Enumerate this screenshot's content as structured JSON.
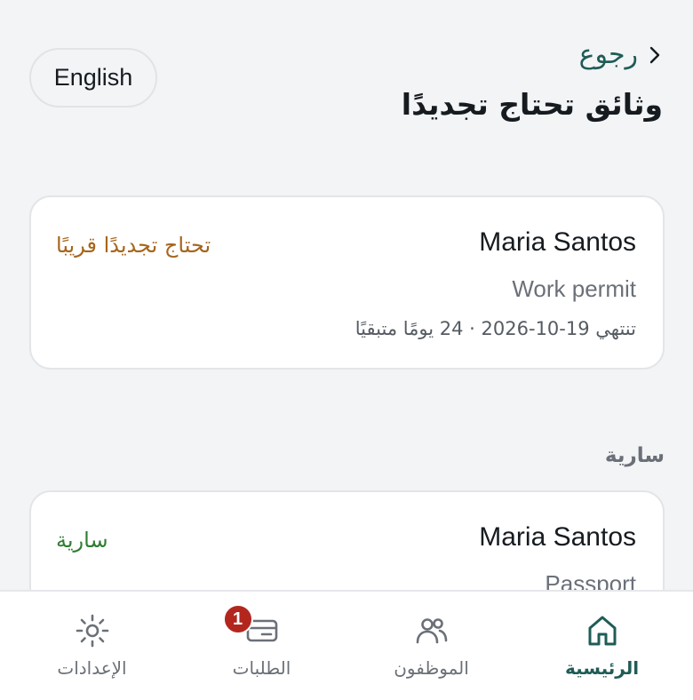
{
  "header": {
    "back_label": "رجوع",
    "title": "وثائق تحتاج تجديدًا",
    "language_toggle": "English"
  },
  "documents": [
    {
      "name": "Maria Santos",
      "document": "Work permit",
      "status": "تحتاج تجديدًا قريبًا",
      "expiry": "تنتهي 19-10-2026 · 24 يومًا متبقيًا",
      "status_color": "#a6651b"
    },
    {
      "name": "Maria Santos",
      "document": "Passport",
      "status": "سارية",
      "status_color": "#2e7d32"
    }
  ],
  "sections": {
    "valid_label": "سارية"
  },
  "nav": {
    "items": [
      {
        "label": "الرئيسية",
        "icon": "home-icon",
        "active": true
      },
      {
        "label": "الموظفون",
        "icon": "people-icon",
        "active": false
      },
      {
        "label": "الطلبات",
        "icon": "card-icon",
        "active": false,
        "badge": "1"
      },
      {
        "label": "الإعدادات",
        "icon": "sun-icon",
        "active": false
      }
    ]
  },
  "colors": {
    "accent": "#1f5c56",
    "background": "#f3f4f6",
    "badge": "#b3261e"
  }
}
